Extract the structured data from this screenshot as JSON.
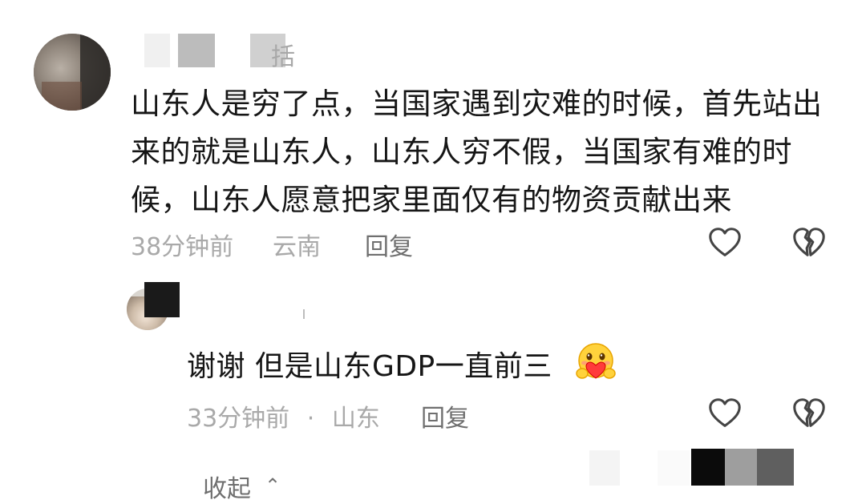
{
  "comment": {
    "author_partial": "括",
    "text": "山东人是穷了点，当国家遇到灾难的时候，首先站出来的就是山东人，山东人穷不假，当国家有难的时候，山东人愿意把家里面仅有的物资贡献出来",
    "time": "38分钟前",
    "location": "云南",
    "reply_label": "回复",
    "like_icon": "heart-outline-icon",
    "dislike_icon": "broken-heart-icon"
  },
  "reply": {
    "text": "谢谢 但是山东GDP一直前三",
    "emoji": "hugging-face-emoji",
    "time": "33分钟前",
    "location": "山东",
    "separator": "·",
    "reply_label": "回复",
    "like_icon": "heart-outline-icon",
    "dislike_icon": "broken-heart-icon"
  },
  "footer": {
    "collapse_label": "收起",
    "collapse_icon": "chevron-up-icon"
  },
  "colors": {
    "text_primary": "#161616",
    "text_meta": "#a9a9a9",
    "text_action": "#6f6f6f",
    "icon": "#444444"
  }
}
